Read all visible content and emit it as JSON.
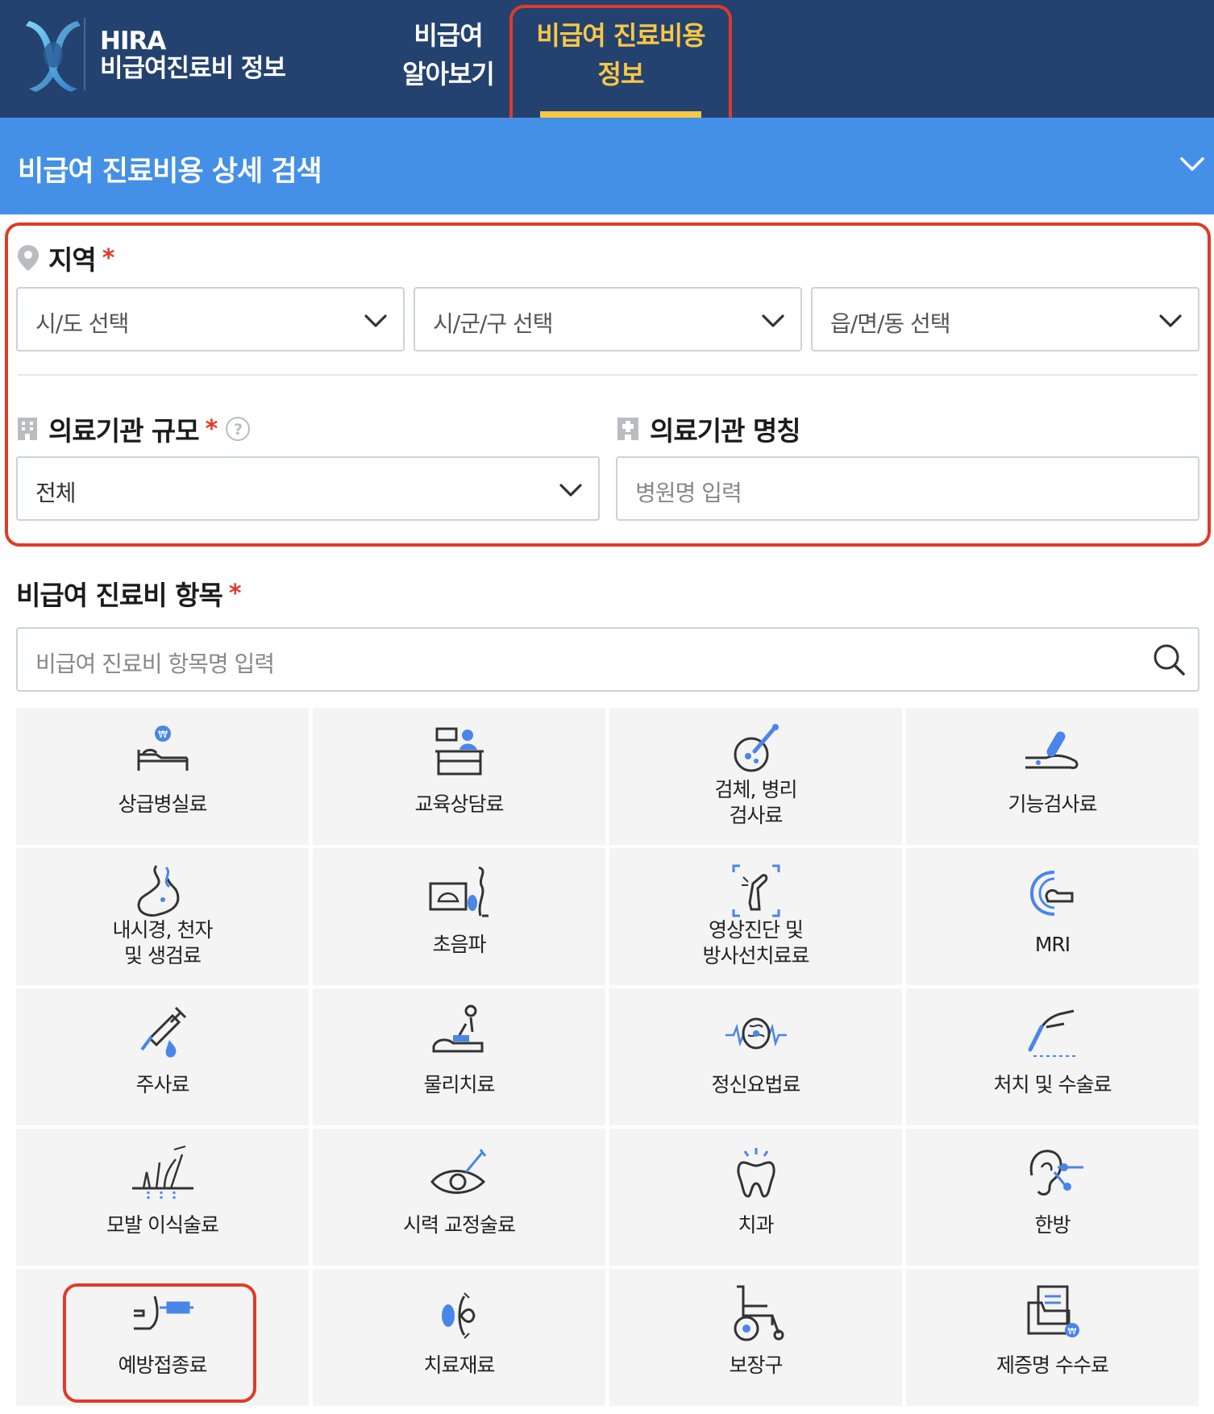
{
  "header": {
    "logo_line1": "HIRA",
    "logo_line2": "비급여진료비 정보",
    "tabs": [
      {
        "line1": "비급여",
        "line2": "알아보기"
      },
      {
        "line1": "비급여 진료비용",
        "line2": "정보"
      }
    ],
    "active_tab_color": "#f7c845",
    "background": "#24426f"
  },
  "search_header": {
    "title": "비급여 진료비용 상세 검색",
    "background": "#4490e6"
  },
  "region": {
    "label": "지역",
    "required_mark": "*",
    "selects": [
      "시/도 선택",
      "시/군/구 선택",
      "읍/면/동 선택"
    ]
  },
  "institution_scale": {
    "label": "의료기관 규모",
    "required_mark": "*",
    "selected_value": "전체"
  },
  "institution_name": {
    "label": "의료기관 명칭",
    "placeholder": "병원명 입력"
  },
  "items": {
    "label": "비급여 진료비 항목",
    "required_mark": "*",
    "search_placeholder": "비급여 진료비 항목명 입력",
    "categories": [
      {
        "l1": "상급병실료",
        "l2": "",
        "icon": "hospital-bed-icon"
      },
      {
        "l1": "교육상담료",
        "l2": "",
        "icon": "consultation-icon"
      },
      {
        "l1": "검체, 병리",
        "l2": "검사료",
        "icon": "specimen-test-icon"
      },
      {
        "l1": "기능검사료",
        "l2": "",
        "icon": "function-test-icon"
      },
      {
        "l1": "내시경, 천자",
        "l2": "및 생검료",
        "icon": "endoscope-icon"
      },
      {
        "l1": "초음파",
        "l2": "",
        "icon": "ultrasound-icon"
      },
      {
        "l1": "영상진단 및",
        "l2": "방사선치료료",
        "icon": "xray-icon"
      },
      {
        "l1": "MRI",
        "l2": "",
        "icon": "mri-icon"
      },
      {
        "l1": "주사료",
        "l2": "",
        "icon": "syringe-icon"
      },
      {
        "l1": "물리치료",
        "l2": "",
        "icon": "physical-therapy-icon"
      },
      {
        "l1": "정신요법료",
        "l2": "",
        "icon": "brain-wave-icon"
      },
      {
        "l1": "처치 및 수술료",
        "l2": "",
        "icon": "surgery-icon"
      },
      {
        "l1": "모발 이식술료",
        "l2": "",
        "icon": "hair-transplant-icon"
      },
      {
        "l1": "시력 교정술료",
        "l2": "",
        "icon": "eye-surgery-icon"
      },
      {
        "l1": "치과",
        "l2": "",
        "icon": "tooth-icon"
      },
      {
        "l1": "한방",
        "l2": "",
        "icon": "acupuncture-icon"
      },
      {
        "l1": "예방접종료",
        "l2": "",
        "icon": "vaccination-icon"
      },
      {
        "l1": "치료재료",
        "l2": "",
        "icon": "treatment-material-icon"
      },
      {
        "l1": "보장구",
        "l2": "",
        "icon": "wheelchair-icon"
      },
      {
        "l1": "제증명 수수료",
        "l2": "",
        "icon": "certificate-fee-icon"
      }
    ]
  }
}
